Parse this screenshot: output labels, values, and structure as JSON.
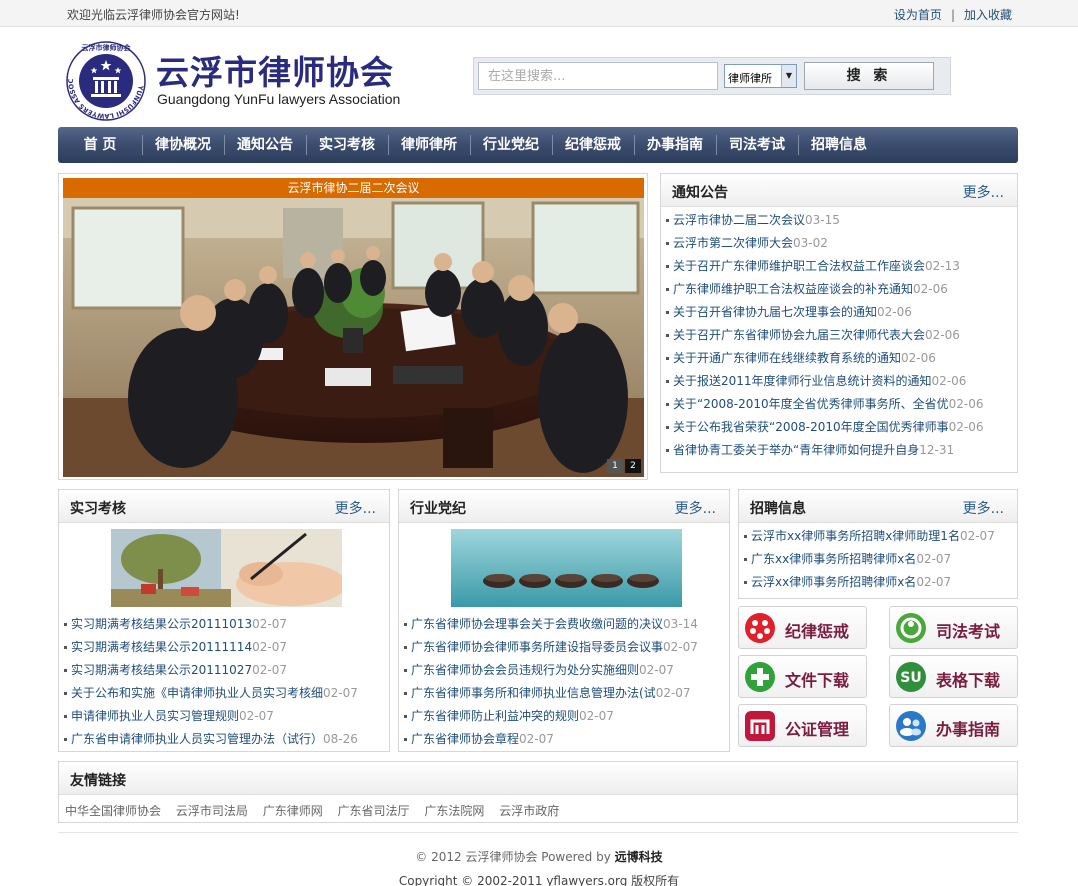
{
  "topbar": {
    "welcome": "欢迎光临云浮律师协会官方网站!",
    "set_home": "设为首页",
    "separator": "|",
    "add_favorite": "加入收藏"
  },
  "header": {
    "title": "云浮市律师协会",
    "subtitle": "Guangdong YunFu lawyers Association",
    "logo_ring_text": "YUNFUSHI LAWYERS ASSOCIATION",
    "logo_top_text": "云浮市律师协会"
  },
  "search": {
    "placeholder": "在这里搜索...",
    "select_value": "律师律所",
    "button_label": "搜 索"
  },
  "nav": [
    "首 页",
    "律协概况",
    "通知公告",
    "实习考核",
    "律师律所",
    "行业党纪",
    "纪律惩戒",
    "办事指南",
    "司法考试",
    "招聘信息"
  ],
  "slideshow": {
    "caption": "云浮市律协二届二次会议",
    "dots": [
      "1",
      "2"
    ]
  },
  "notice": {
    "title": "通知公告",
    "more": "更多...",
    "items": [
      {
        "text": "云浮市律协二届二次会议",
        "date": "03-15"
      },
      {
        "text": "云浮市第二次律师大会",
        "date": "03-02"
      },
      {
        "text": "关于召开广东律师维护职工合法权益工作座谈会",
        "date": "02-13"
      },
      {
        "text": "广东律师维护职工合法权益座谈会的补充通知",
        "date": "02-06"
      },
      {
        "text": "关于召开省律协九届七次理事会的通知",
        "date": "02-06"
      },
      {
        "text": "关于召开广东省律师协会九届三次律师代表大会",
        "date": "02-06"
      },
      {
        "text": "关于开通广东律师在线继续教育系统的通知",
        "date": "02-06"
      },
      {
        "text": "关于报送2011年度律师行业信息统计资料的通知",
        "date": "02-06"
      },
      {
        "text": "关于“2008-2010年度全省优秀律师事务所、全省优",
        "date": "02-06"
      },
      {
        "text": "关于公布我省荣获“2008-2010年度全国优秀律师事",
        "date": "02-06"
      },
      {
        "text": "省律协青工委关于举办“青年律师如何提升自身",
        "date": "12-31"
      }
    ]
  },
  "internship": {
    "title": "实习考核",
    "more": "更多...",
    "items": [
      {
        "text": "实习期满考核结果公示20111013",
        "date": "02-07"
      },
      {
        "text": "实习期满考核结果公示20111114",
        "date": "02-07"
      },
      {
        "text": "实习期满考核结果公示20111027",
        "date": "02-07"
      },
      {
        "text": "关于公布和实施《申请律师执业人员实习考核细",
        "date": "02-07"
      },
      {
        "text": "申请律师执业人员实习管理规则",
        "date": "02-07"
      },
      {
        "text": "广东省申请律师执业人员实习管理办法（试行）",
        "date": "08-26"
      }
    ]
  },
  "discipline": {
    "title": "行业党纪",
    "more": "更多...",
    "items": [
      {
        "text": "广东省律师协会理事会关于会费收缴问题的决议",
        "date": "03-14"
      },
      {
        "text": "广东省律师协会律师事务所建设指导委员会议事",
        "date": "02-07"
      },
      {
        "text": "广东省律师协会会员违规行为处分实施细则",
        "date": "02-07"
      },
      {
        "text": "广东省律师事务所和律师执业信息管理办法(试",
        "date": "02-07"
      },
      {
        "text": "广东省律师防止利益冲突的规则",
        "date": "02-07"
      },
      {
        "text": "广东省律师协会章程",
        "date": "02-07"
      }
    ]
  },
  "recruit": {
    "title": "招聘信息",
    "more": "更多...",
    "items": [
      {
        "text": "云浮市xx律师事务所招聘x律师助理1名",
        "date": "02-07"
      },
      {
        "text": "广东xx律师事务所招聘律师x名",
        "date": "02-07"
      },
      {
        "text": "云浮xx律师事务所招聘律师x名",
        "date": "02-07"
      }
    ]
  },
  "quick_links": [
    {
      "label": "纪律惩戒",
      "icon": "discipline-icon",
      "color": "#e0202a"
    },
    {
      "label": "司法考试",
      "icon": "exam-icon",
      "color": "#4aa83a"
    },
    {
      "label": "文件下载",
      "icon": "plus-icon",
      "color": "#2fa33a"
    },
    {
      "label": "表格下载",
      "icon": "stumble-icon",
      "color": "#2f8f3a"
    },
    {
      "label": "公证管理",
      "icon": "notary-icon",
      "color": "#c0183c"
    },
    {
      "label": "办事指南",
      "icon": "people-icon",
      "color": "#2a78c8"
    }
  ],
  "friend_links": {
    "title": "友情链接",
    "items": [
      "中华全国律师协会",
      "云浮市司法局",
      "广东律师网",
      "广东省司法厅",
      "广东法院网",
      "云浮市政府"
    ]
  },
  "footer": {
    "line1_prefix": "© 2012 云浮律师协会 Powered by",
    "line1_brand": "远博科技",
    "line2": "Copyright © 2002-2011 yflawyers.org 版权所有"
  }
}
